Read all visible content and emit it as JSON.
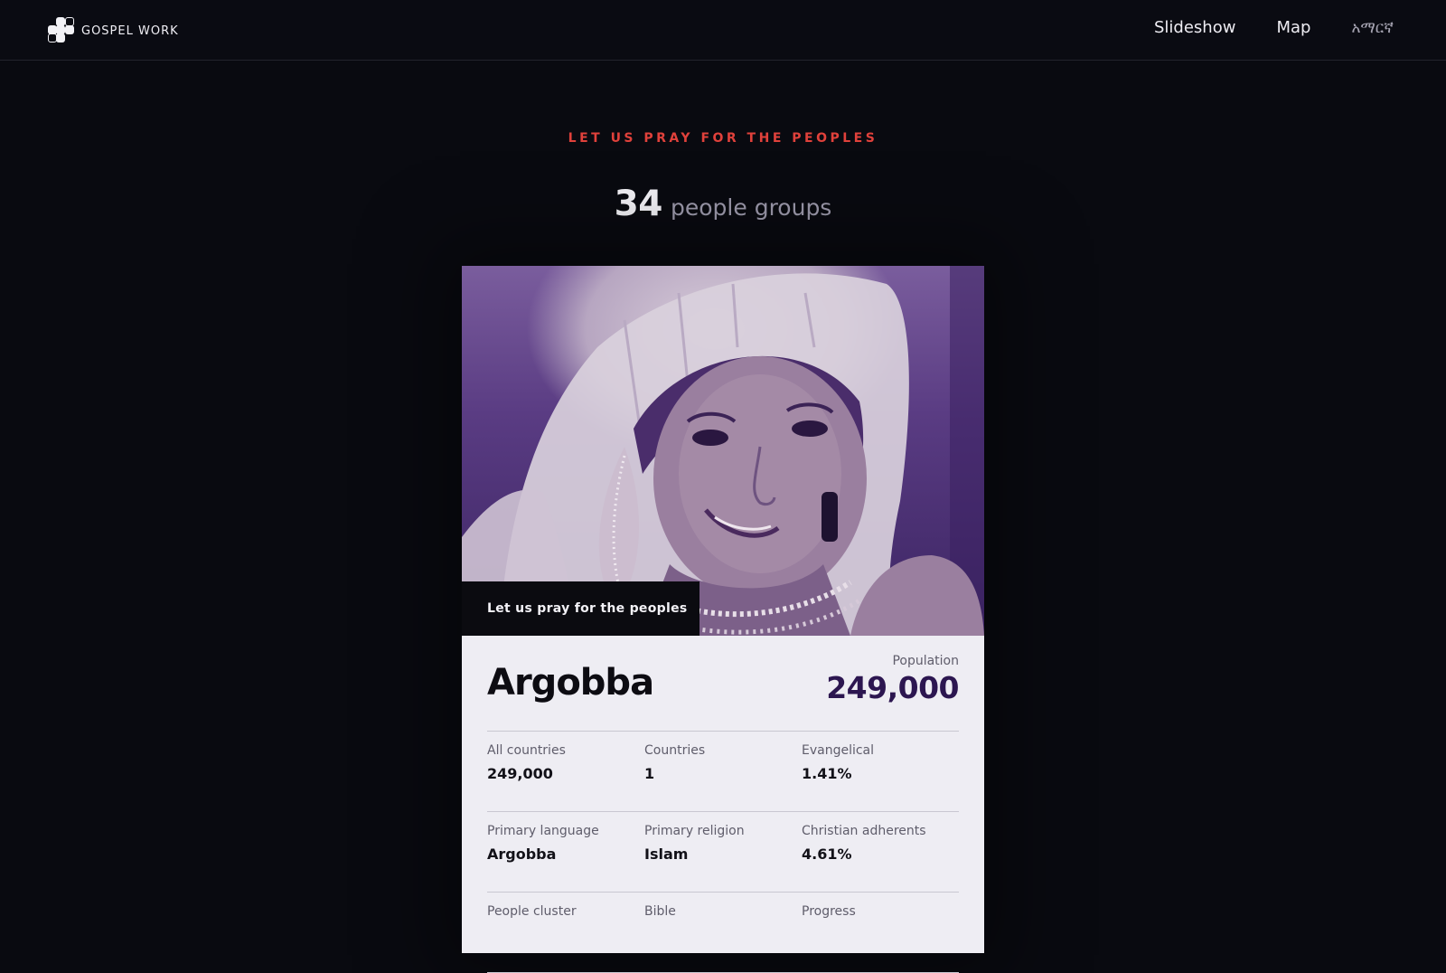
{
  "header": {
    "brand": "GOSPEL WORK",
    "nav": [
      "Slideshow",
      "Map",
      "አማርኛ"
    ]
  },
  "hero": {
    "eyebrow": "LET US PRAY FOR THE PEOPLES",
    "count": "34",
    "count_label": "people groups"
  },
  "card": {
    "photo_caption": "Let us pray for the peoples",
    "name": "Argobba",
    "population_label": "Population",
    "population_value": "249,000",
    "stats": [
      [
        {
          "label": "All countries",
          "value": "249,000"
        },
        {
          "label": "Countries",
          "value": "1"
        },
        {
          "label": "Evangelical",
          "value": "1.41%"
        }
      ],
      [
        {
          "label": "Primary language",
          "value": "Argobba"
        },
        {
          "label": "Primary religion",
          "value": "Islam"
        },
        {
          "label": "Christian adherents",
          "value": "4.61%"
        }
      ],
      [
        {
          "label": "People cluster",
          "value": ""
        },
        {
          "label": "Bible",
          "value": ""
        },
        {
          "label": "Progress",
          "value": ""
        }
      ]
    ]
  },
  "colors": {
    "background": "#090a10",
    "accent": "#e0413b",
    "population": "#2c1650",
    "card": "#eeedf3"
  }
}
